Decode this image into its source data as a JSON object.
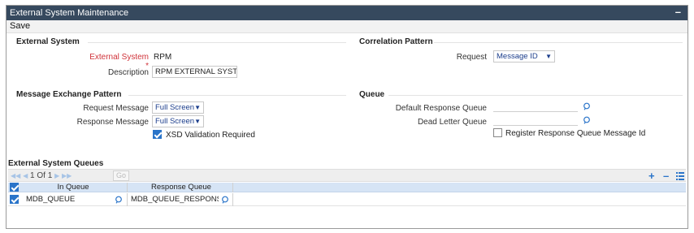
{
  "window": {
    "title": "External System Maintenance",
    "minimize_label": "–"
  },
  "toolbar": {
    "save_label": "Save"
  },
  "external_system": {
    "section_title": "External System",
    "system_label": "External System",
    "required_marker": "*",
    "system_value": "RPM",
    "description_label": "Description",
    "description_value": "RPM  EXTERNAL SYSTEI"
  },
  "correlation_pattern": {
    "section_title": "Correlation Pattern",
    "request_label": "Request",
    "request_value": "Message ID"
  },
  "message_exchange_pattern": {
    "section_title": "Message Exchange Pattern",
    "request_message_label": "Request Message",
    "request_message_value": "Full Screen",
    "response_message_label": "Response Message",
    "response_message_value": "Full Screen",
    "xsd_label": "XSD Validation Required",
    "xsd_checked": true
  },
  "queue": {
    "section_title": "Queue",
    "default_response_label": "Default Response Queue",
    "default_response_value": "",
    "dead_letter_label": "Dead Letter Queue",
    "dead_letter_value": "",
    "register_label": "Register Response Queue Message Id",
    "register_checked": false
  },
  "external_system_queues": {
    "section_title": "External System Queues",
    "pager_text": "1 Of 1",
    "go_label": "Go",
    "columns": [
      "In Queue",
      "Response Queue"
    ],
    "rows": [
      {
        "in_queue": "MDB_QUEUE",
        "response_queue": "MDB_QUEUE_RESPONS",
        "checked": true
      }
    ]
  },
  "colors": {
    "titlebar": "#36495e",
    "accent": "#2a74c9",
    "required": "#d0333a",
    "grid_header": "#d6e4f5"
  },
  "icons": [
    "minimize-icon",
    "chevron-down-icon",
    "lov-search-icon",
    "first-page-icon",
    "prev-page-icon",
    "next-page-icon",
    "last-page-icon",
    "add-row-icon",
    "delete-row-icon",
    "single-view-icon"
  ]
}
